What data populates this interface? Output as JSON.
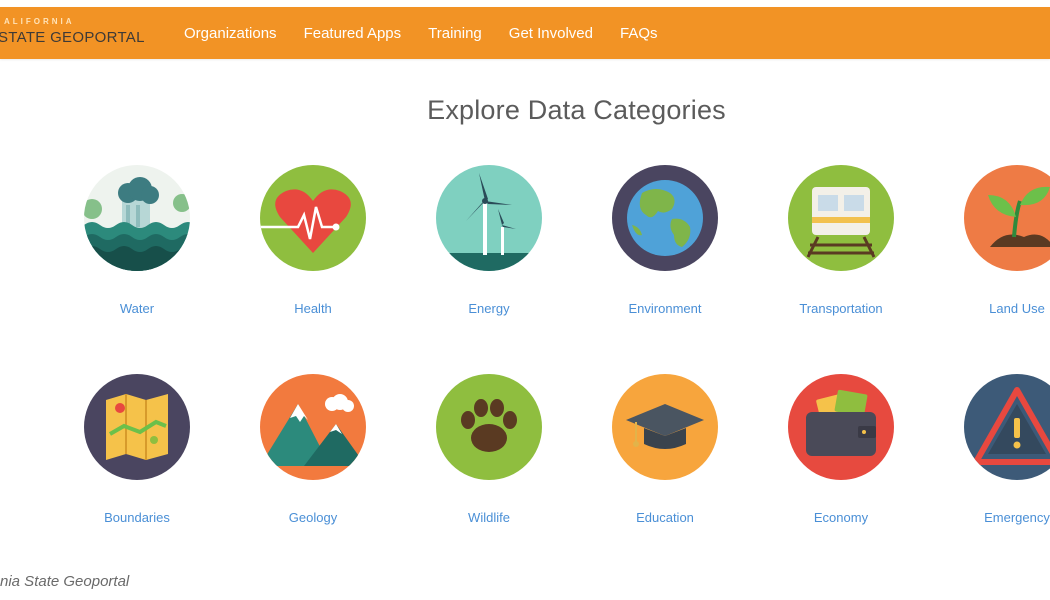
{
  "header": {
    "brand_top": "ALIFORNIA",
    "brand_main": "STATE GEOPORTAL",
    "nav": [
      "Organizations",
      "Featured Apps",
      "Training",
      "Get Involved",
      "FAQs"
    ]
  },
  "main": {
    "title": "Explore Data Categories",
    "row1": [
      {
        "label": "Water",
        "icon": "water-icon"
      },
      {
        "label": "Health",
        "icon": "heart-icon"
      },
      {
        "label": "Energy",
        "icon": "wind-turbine-icon"
      },
      {
        "label": "Environment",
        "icon": "globe-icon"
      },
      {
        "label": "Transportation",
        "icon": "train-icon"
      },
      {
        "label": "Land Use",
        "icon": "sprout-icon"
      }
    ],
    "row2": [
      {
        "label": "Boundaries",
        "icon": "map-icon"
      },
      {
        "label": "Geology",
        "icon": "mountain-icon"
      },
      {
        "label": "Wildlife",
        "icon": "paw-print-icon"
      },
      {
        "label": "Education",
        "icon": "graduation-cap-icon"
      },
      {
        "label": "Economy",
        "icon": "wallet-icon"
      },
      {
        "label": "Emergency",
        "icon": "warning-icon"
      }
    ]
  },
  "caption": "nia State Geoportal",
  "colors": {
    "header_bg": "#f29325",
    "link": "#4a8fd6",
    "heading": "#5b5b5b"
  }
}
